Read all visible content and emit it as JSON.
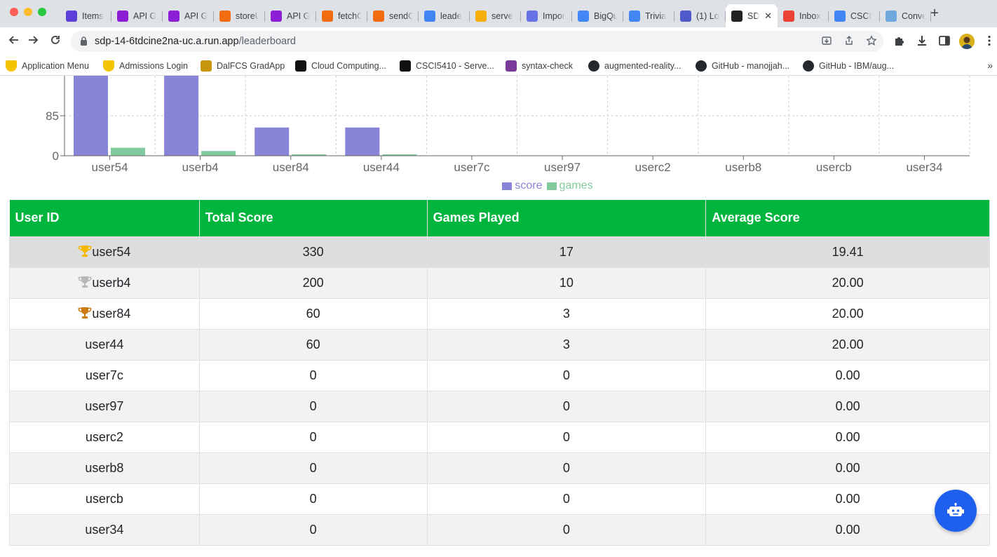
{
  "browser": {
    "tabs": [
      {
        "label": "Items",
        "icon": "notion-icon",
        "color": "#5b3fd8"
      },
      {
        "label": "API G",
        "icon": "api-gateway-icon",
        "color": "#8c1fd6"
      },
      {
        "label": "API G",
        "icon": "api-gateway-icon",
        "color": "#8c1fd6"
      },
      {
        "label": "storeU",
        "icon": "lambda-icon",
        "color": "#f26b0f"
      },
      {
        "label": "API G",
        "icon": "api-gateway-icon",
        "color": "#8c1fd6"
      },
      {
        "label": "fetchG",
        "icon": "lambda-icon",
        "color": "#f26b0f"
      },
      {
        "label": "sendG",
        "icon": "lambda-icon",
        "color": "#f26b0f"
      },
      {
        "label": "leade",
        "icon": "code-icon",
        "color": "#4285f4"
      },
      {
        "label": "serve",
        "icon": "firebase-icon",
        "color": "#f6ae0b"
      },
      {
        "label": "Impor",
        "icon": "stripe-icon",
        "color": "#6772e5"
      },
      {
        "label": "BigQu",
        "icon": "bigquery-icon",
        "color": "#4285f4"
      },
      {
        "label": "Trivia",
        "icon": "cloud-function-icon",
        "color": "#4285f4"
      },
      {
        "label": "(1) Lo",
        "icon": "teams-icon",
        "color": "#5059c9"
      },
      {
        "label": "SD",
        "icon": "react-icon",
        "color": "#222222",
        "active": true
      },
      {
        "label": "Inbox",
        "icon": "gmail-icon",
        "color": "#ea4335"
      },
      {
        "label": "CSCI",
        "icon": "docs-icon",
        "color": "#4285f4"
      },
      {
        "label": "Conve",
        "icon": "convert-icon",
        "color": "#6fa8dc"
      }
    ],
    "url_host": "sdp-14-6tdcine2na-uc.a.run.app",
    "url_path": "/leaderboard",
    "bookmarks": [
      {
        "label": "Application Menu",
        "icon": "dal-shield-icon"
      },
      {
        "label": "Admissions Login",
        "icon": "dal-shield-icon"
      },
      {
        "label": "DalFCS GradApp",
        "icon": "graduation-cap-icon"
      },
      {
        "label": "Cloud Computing...",
        "icon": "d2l-icon"
      },
      {
        "label": "CSCI5410 - Serve...",
        "icon": "d2l-icon"
      },
      {
        "label": "syntax-check",
        "icon": "color-bars-icon"
      },
      {
        "label": "augmented-reality...",
        "icon": "github-icon"
      },
      {
        "label": "GitHub - manojjah...",
        "icon": "github-icon"
      },
      {
        "label": "GitHub - IBM/aug...",
        "icon": "github-icon"
      }
    ]
  },
  "chart_data": {
    "type": "bar",
    "categories": [
      "user54",
      "userb4",
      "user84",
      "user44",
      "user7c",
      "user97",
      "userc2",
      "userb8",
      "usercb",
      "user34"
    ],
    "series": [
      {
        "name": "score",
        "values": [
          330,
          200,
          60,
          60,
          0,
          0,
          0,
          0,
          0,
          0
        ],
        "color": "#8884d8"
      },
      {
        "name": "games",
        "values": [
          17,
          10,
          3,
          3,
          0,
          0,
          0,
          0,
          0,
          0
        ],
        "color": "#82ca9d"
      }
    ],
    "y_ticks_visible": [
      "0",
      "85"
    ],
    "grid": true,
    "legend_position": "bottom"
  },
  "table": {
    "headers": [
      "User ID",
      "Total Score",
      "Games Played",
      "Average Score"
    ],
    "header_color": "#00b53e",
    "rows": [
      {
        "user": "user54",
        "score": "330",
        "games": "17",
        "avg": "19.41",
        "trophy": "gold"
      },
      {
        "user": "userb4",
        "score": "200",
        "games": "10",
        "avg": "20.00",
        "trophy": "silver"
      },
      {
        "user": "user84",
        "score": "60",
        "games": "3",
        "avg": "20.00",
        "trophy": "bronze"
      },
      {
        "user": "user44",
        "score": "60",
        "games": "3",
        "avg": "20.00",
        "trophy": ""
      },
      {
        "user": "user7c",
        "score": "0",
        "games": "0",
        "avg": "0.00",
        "trophy": ""
      },
      {
        "user": "user97",
        "score": "0",
        "games": "0",
        "avg": "0.00",
        "trophy": ""
      },
      {
        "user": "userc2",
        "score": "0",
        "games": "0",
        "avg": "0.00",
        "trophy": ""
      },
      {
        "user": "userb8",
        "score": "0",
        "games": "0",
        "avg": "0.00",
        "trophy": ""
      },
      {
        "user": "usercb",
        "score": "0",
        "games": "0",
        "avg": "0.00",
        "trophy": ""
      },
      {
        "user": "user34",
        "score": "0",
        "games": "0",
        "avg": "0.00",
        "trophy": ""
      }
    ]
  },
  "chatbot": {
    "icon": "robot-icon",
    "color": "#1e5ff0"
  }
}
